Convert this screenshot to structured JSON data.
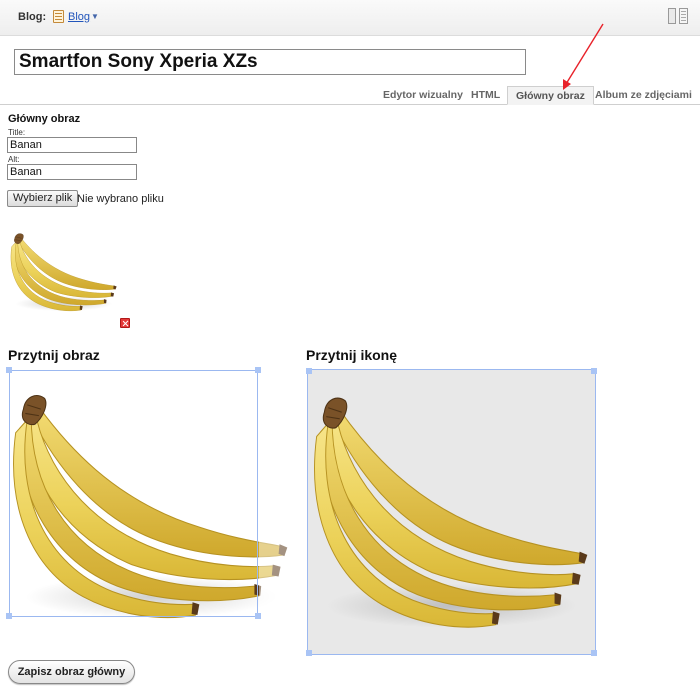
{
  "topbar": {
    "blog_label": "Blog:",
    "blog_link": "Blog",
    "caret": "▼",
    "layout_icon": "two-column-layout-icon"
  },
  "post": {
    "title_value": "Smartfon Sony Xperia XZs"
  },
  "tabs": [
    {
      "label": "Edytor wizualny",
      "active": false
    },
    {
      "label": "HTML",
      "active": false
    },
    {
      "label": "Główny obraz",
      "active": true
    },
    {
      "label": "Album ze zdjęciami",
      "active": false
    }
  ],
  "main_image": {
    "heading": "Główny obraz",
    "title_label": "Title:",
    "title_value": "Banan",
    "alt_label": "Alt:",
    "alt_value": "Banan",
    "choose_file_label": "Wybierz plik",
    "file_status": "Nie wybrano pliku",
    "delete_icon": "delete-icon"
  },
  "crop": {
    "image_heading": "Przytnij obraz",
    "icon_heading": "Przytnij ikonę"
  },
  "actions": {
    "save_label": "Zapisz obraz główny"
  },
  "colors": {
    "link": "#2255bb",
    "selection": "#9bb8f0",
    "annotation_arrow": "#e8222a",
    "delete": "#e53a3a"
  }
}
